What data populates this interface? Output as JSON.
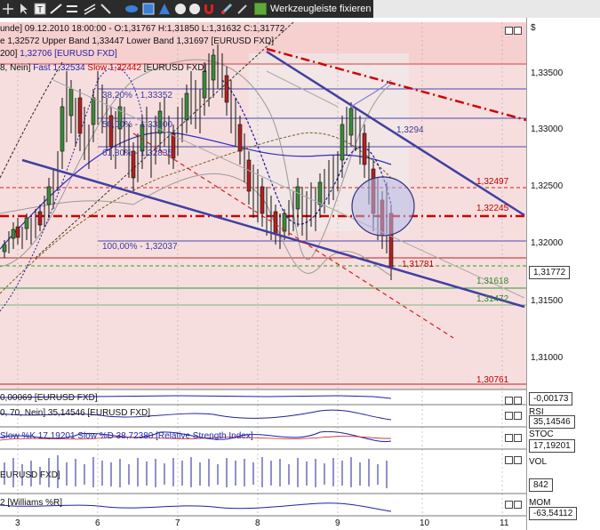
{
  "toolbar": {
    "icons": [
      "move-icon",
      "cursor-icon",
      "text-icon",
      "trendline-icon",
      "channel-icon",
      "ellipse-icon",
      "rectangle-icon",
      "triangle-icon",
      "circle-icon",
      "circle-icon",
      "magnet-icon",
      "paint-icon",
      "brush-icon"
    ],
    "fix_label": "Werkzeugleiste fixieren"
  },
  "main_panel": {
    "header1": "unde] 09.12.2010 18:00:00 - O:1,31767 H:1,31850 L:1,31632 C:1,31772",
    "header2": "e 1,32572 Upper Band 1,33447 Lower Band 1,31697 [EURUSD FXD]",
    "header3_prefix": "200] ",
    "header3_value": "1,32706 [EURUSD FXD]",
    "header4_prefix": "8, Nein] ",
    "header4_fast": "Fast 1,32534",
    "header4_slow": "Slow 1,32442",
    "header4_suffix": " [EURUSD FXD]",
    "fib_labels": [
      {
        "text": "38,20% - 1,33352"
      },
      {
        "text": "50,00% - 1,33100"
      },
      {
        "text": "61,80% - 1,32835"
      },
      {
        "text": "100,00% - 1,32037"
      }
    ],
    "level_labels": [
      {
        "text": "1,3294",
        "color": "#3a3a9a"
      },
      {
        "text": "1,32497",
        "color": "#c00000"
      },
      {
        "text": "1,32245",
        "color": "#c00000"
      },
      {
        "text": "1,31781",
        "color": "#c00000"
      },
      {
        "text": "1,31618",
        "color": "#2a8a2a"
      },
      {
        "text": "1,31472",
        "color": "#2a8a2a"
      },
      {
        "text": "1,30761",
        "color": "#c00000"
      }
    ]
  },
  "price_axis": {
    "currency_symbol": "$",
    "ticks": [
      "1,33500",
      "1,33000",
      "1,32500",
      "1,32000",
      "1,31500",
      "1,31000"
    ],
    "current_price": "1,31772"
  },
  "subpanels": [
    {
      "header": "0,00069 [EURUSD FXD]",
      "value": "-0,00173",
      "label": ""
    },
    {
      "header": "0, 70, Nein] 35,14546 [EURUSD FXD]",
      "value": "35,14546",
      "label": "RSI"
    },
    {
      "header": "Slow %K 17,19201 Slow %D 38,72380 [Relative Strength Index]",
      "value": "17,19201",
      "label": "STOC"
    },
    {
      "header": "EURUSD FXD]",
      "value": "842",
      "label": "VOL"
    },
    {
      "header": "2 [Williams %R]",
      "value": "-63,54112",
      "label": "MOM"
    }
  ],
  "x_axis": {
    "ticks": [
      "3",
      "6",
      "7",
      "8",
      "9",
      "10",
      "11"
    ]
  },
  "colors": {
    "bg_pink": "#f5d5d5",
    "trend_blue": "#4a4aa0",
    "red_dash": "#d00000",
    "green_line": "#2a9a2a"
  }
}
